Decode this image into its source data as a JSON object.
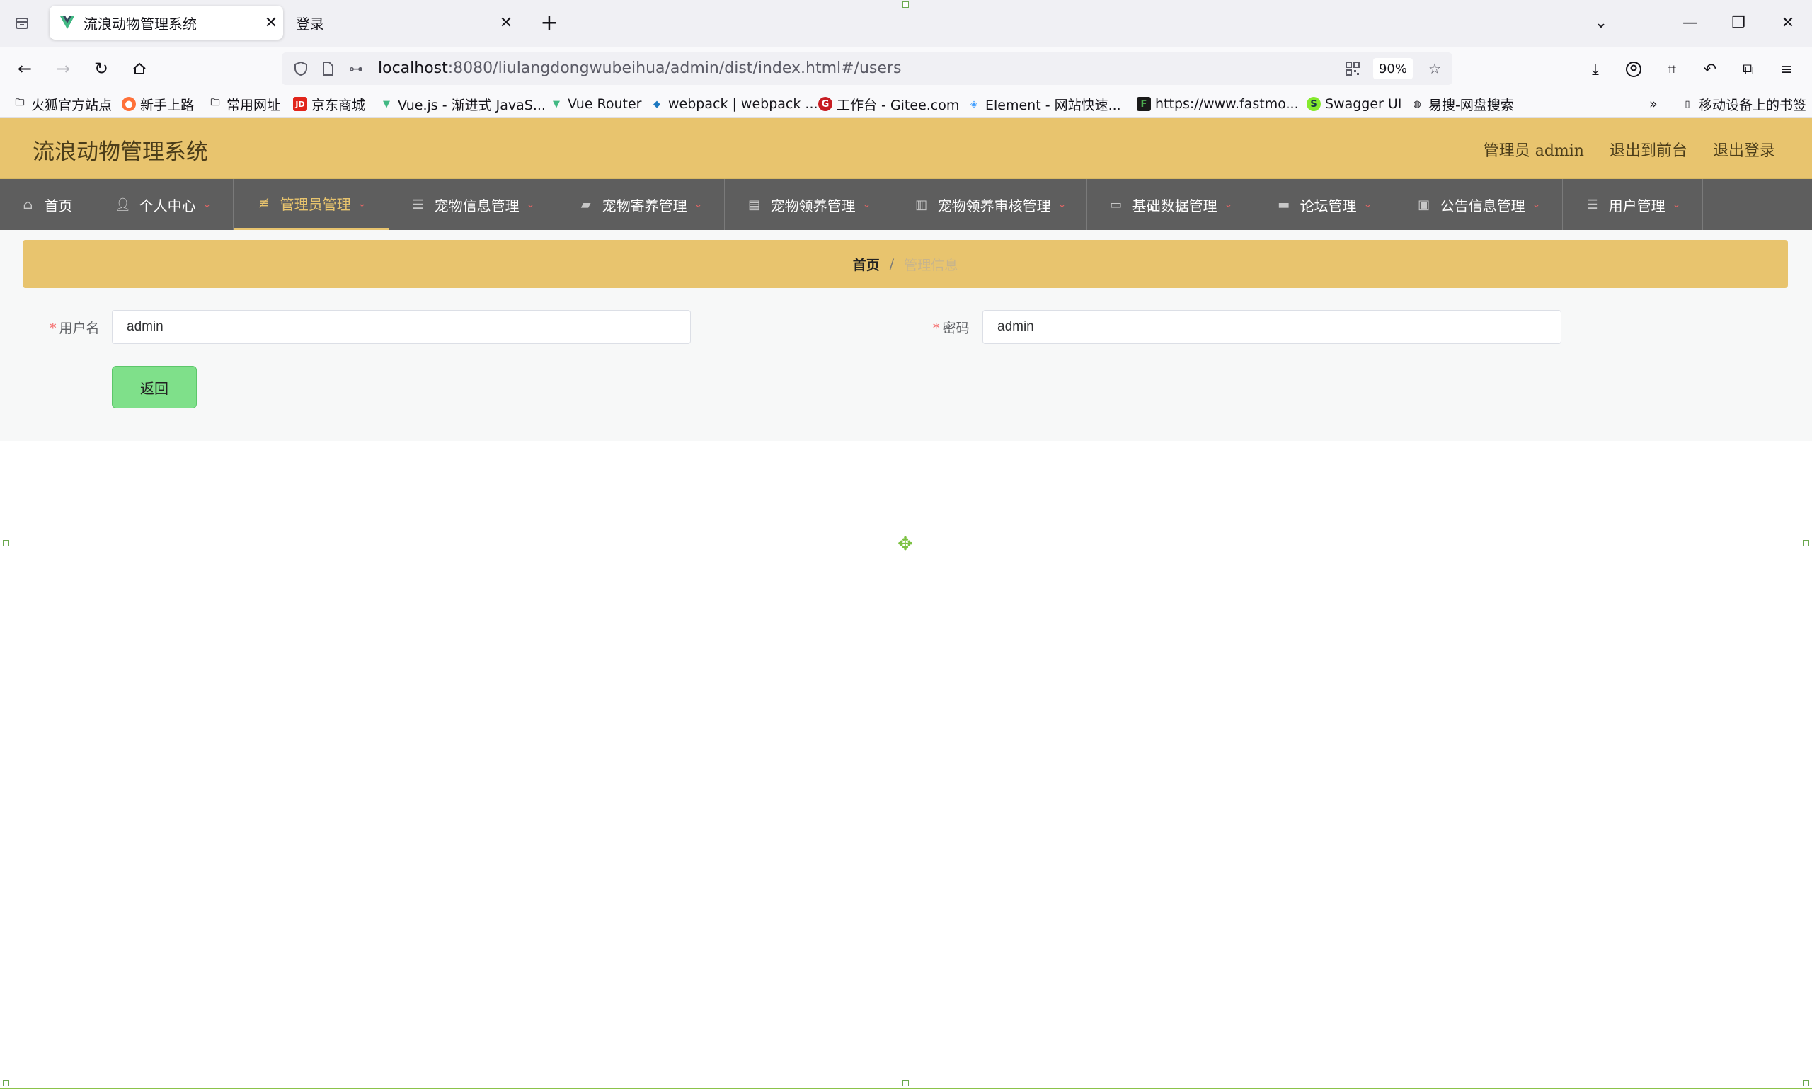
{
  "browser": {
    "tabs": [
      {
        "title": "流浪动物管理系统",
        "active": true,
        "favicon": "vue-icon"
      },
      {
        "title": "登录",
        "active": false
      }
    ],
    "url_host": "localhost",
    "url_rest": ":8080/liulangdongwubeihua/admin/dist/index.html#/users",
    "zoom": "90%",
    "bookmarks": [
      {
        "label": "火狐官方站点",
        "icon": "folder-icon"
      },
      {
        "label": "新手上路",
        "icon": "firefox-icon"
      },
      {
        "label": "常用网址",
        "icon": "folder-icon"
      },
      {
        "label": "京东商城",
        "icon": "jd-icon"
      },
      {
        "label": "Vue.js - 渐进式 JavaS...",
        "icon": "vue-icon"
      },
      {
        "label": "Vue Router",
        "icon": "vue-icon"
      },
      {
        "label": "webpack | webpack ...",
        "icon": "webpack-icon"
      },
      {
        "label": "工作台 - Gitee.com",
        "icon": "gitee-icon"
      },
      {
        "label": "Element - 网站快速...",
        "icon": "element-icon"
      },
      {
        "label": "https://www.fastmo...",
        "icon": "fastmock-icon"
      },
      {
        "label": "Swagger UI",
        "icon": "swagger-icon"
      },
      {
        "label": "易搜-网盘搜索",
        "icon": "globe-icon"
      }
    ],
    "mobile_bookmarks": "移动设备上的书签"
  },
  "app": {
    "title": "流浪动物管理系统",
    "header_links": {
      "role_user": "管理员 admin",
      "to_front": "退出到前台",
      "logout": "退出登录"
    },
    "menu": [
      {
        "label": "首页",
        "icon": "home-icon",
        "has_dropdown": false,
        "active": false
      },
      {
        "label": "个人中心",
        "icon": "user-icon",
        "has_dropdown": true,
        "active": false
      },
      {
        "label": "管理员管理",
        "icon": "sliders-icon",
        "has_dropdown": true,
        "active": true
      },
      {
        "label": "宠物信息管理",
        "icon": "list-icon",
        "has_dropdown": true,
        "active": false
      },
      {
        "label": "宠物寄养管理",
        "icon": "ticket-icon",
        "has_dropdown": true,
        "active": false
      },
      {
        "label": "宠物领养管理",
        "icon": "clipboard-icon",
        "has_dropdown": true,
        "active": false
      },
      {
        "label": "宠物领养审核管理",
        "icon": "book-icon",
        "has_dropdown": true,
        "active": false
      },
      {
        "label": "基础数据管理",
        "icon": "monitor-icon",
        "has_dropdown": true,
        "active": false
      },
      {
        "label": "论坛管理",
        "icon": "inbox-icon",
        "has_dropdown": true,
        "active": false
      },
      {
        "label": "公告信息管理",
        "icon": "briefcase-icon",
        "has_dropdown": true,
        "active": false
      },
      {
        "label": "用户管理",
        "icon": "list-icon",
        "has_dropdown": true,
        "active": false
      }
    ],
    "breadcrumb": {
      "home": "首页",
      "separator": "/",
      "current": "管理信息"
    },
    "form": {
      "username": {
        "label": "用户名",
        "value": "admin"
      },
      "password": {
        "label": "密码",
        "value": "admin"
      },
      "back_button": "返回"
    },
    "colors": {
      "header_bg": "#e8c46e",
      "menu_bg": "#5e5e5e",
      "active_accent": "#e8c46e",
      "back_button": "#7fe08a",
      "required_star": "#f56c6c"
    }
  }
}
